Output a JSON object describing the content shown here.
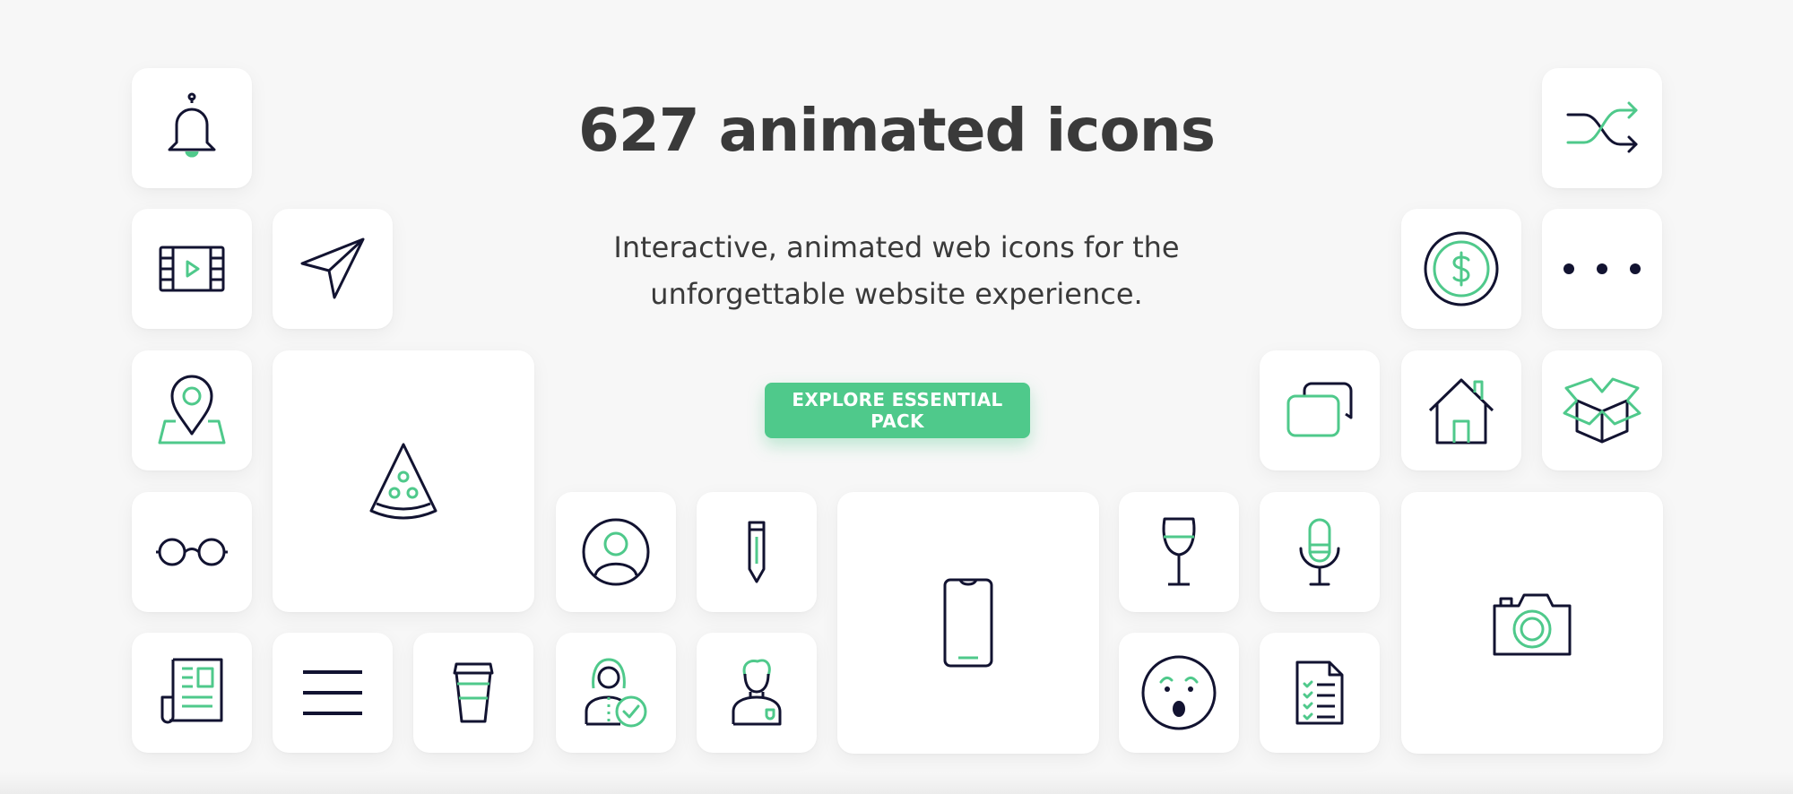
{
  "hero": {
    "title": "627 animated icons",
    "subtitle_line1": "Interactive, animated web icons for the",
    "subtitle_line2": "unforgettable website experience.",
    "cta_label": "EXPLORE ESSENTIAL PACK"
  },
  "colors": {
    "background": "#f7f7f7",
    "tile": "#ffffff",
    "icon_stroke": "#121331",
    "accent": "#4fc98b",
    "title_text": "#3a3a3a"
  },
  "icons": [
    "bell-icon",
    "film-play-icon",
    "send-icon",
    "map-pin-icon",
    "pizza-slice-icon",
    "glasses-icon",
    "newspaper-icon",
    "menu-icon",
    "coffee-cup-icon",
    "user-avatar-icon",
    "pencil-icon",
    "user-approved-icon",
    "man-icon",
    "smartphone-icon",
    "wine-glass-icon",
    "surprised-face-icon",
    "microphone-icon",
    "checklist-document-icon",
    "chat-bubbles-icon",
    "home-icon",
    "box-icon",
    "dollar-coin-icon",
    "more-dots-icon",
    "shuffle-icon",
    "camera-icon"
  ]
}
